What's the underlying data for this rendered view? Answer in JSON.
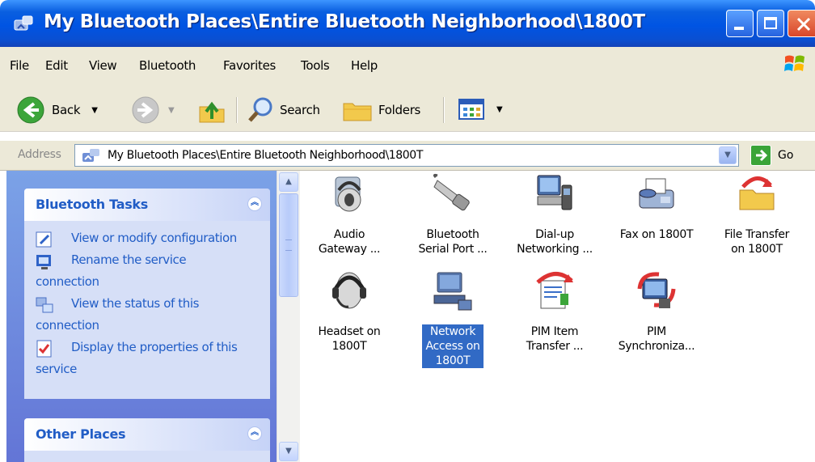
{
  "window": {
    "title": "My Bluetooth Places\\Entire Bluetooth Neighborhood\\1800T",
    "title_icon": "bluetooth-places-icon"
  },
  "menu": [
    "File",
    "Edit",
    "View",
    "Bluetooth",
    "Favorites",
    "Tools",
    "Help"
  ],
  "toolbar": {
    "back_label": "Back",
    "search_label": "Search",
    "folders_label": "Folders"
  },
  "address": {
    "label": "Address",
    "value": "My Bluetooth Places\\Entire Bluetooth Neighborhood\\1800T",
    "go_label": "Go"
  },
  "sidebar": {
    "tasks_title": "Bluetooth Tasks",
    "tasks": [
      {
        "line1": "View or modify configuration",
        "line2": "",
        "icon": "configure-icon"
      },
      {
        "line1": "Rename the service",
        "line2": "connection",
        "icon": "rename-icon"
      },
      {
        "line1": "View the status of this",
        "line2": "connection",
        "icon": "status-icon"
      },
      {
        "line1": "Display the properties of this",
        "line2": "service",
        "icon": "properties-icon"
      }
    ],
    "other_places_title": "Other Places"
  },
  "items": [
    {
      "line1": "Audio",
      "line2": "Gateway ...",
      "icon": "audio-gateway-icon",
      "selected": false
    },
    {
      "line1": "Bluetooth",
      "line2": "Serial Port ...",
      "icon": "serial-port-icon",
      "selected": false
    },
    {
      "line1": "Dial-up",
      "line2": "Networking ...",
      "icon": "dialup-networking-icon",
      "selected": false
    },
    {
      "line1": "Fax on 1800T",
      "line2": "",
      "icon": "fax-icon",
      "selected": false
    },
    {
      "line1": "File Transfer",
      "line2": "on 1800T",
      "icon": "file-transfer-icon",
      "selected": false
    },
    {
      "line1": "Headset on",
      "line2": "1800T",
      "icon": "headset-icon",
      "selected": false
    },
    {
      "line1": "Network",
      "line2": "Access on",
      "line3": "1800T",
      "icon": "network-access-icon",
      "selected": true
    },
    {
      "line1": "PIM Item",
      "line2": "Transfer ...",
      "icon": "pim-item-transfer-icon",
      "selected": false
    },
    {
      "line1": "PIM",
      "line2": "Synchroniza...",
      "icon": "pim-sync-icon",
      "selected": false
    }
  ],
  "colors": {
    "title_bar": "#0054e3",
    "task_pane": "#6f8fe0",
    "task_text": "#215dc6",
    "selection": "#316ac5"
  }
}
